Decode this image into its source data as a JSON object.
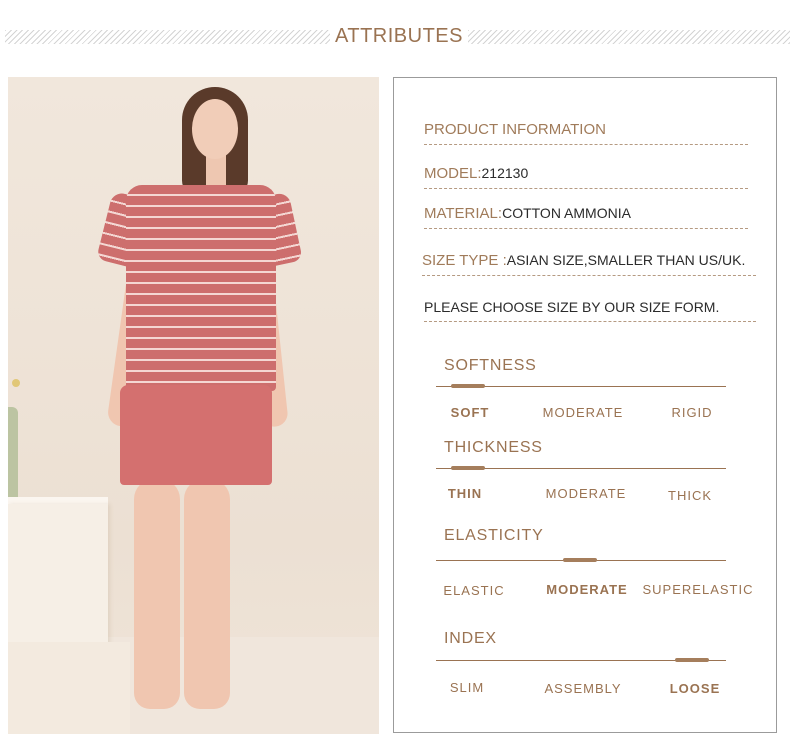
{
  "header": {
    "title": "ATTRIBUTES"
  },
  "product": {
    "info_label": "PRODUCT INFORMATION",
    "model_label": "MODEL:",
    "model_value": "212130",
    "material_label": "MATERIAL:",
    "material_value": "COTTON AMMONIA",
    "size_label": "SIZE TYPE :",
    "size_value": "ASIAN SIZE,SMALLER THAN US/UK.",
    "size_note": "PLEASE CHOOSE SIZE BY OUR SIZE FORM."
  },
  "attributes": [
    {
      "title": "SOFTNESS",
      "options": [
        "SOFT",
        "MODERATE",
        "RIGID"
      ],
      "selected": 0
    },
    {
      "title": "THICKNESS",
      "options": [
        "THIN",
        "MODERATE",
        "THICK"
      ],
      "selected": 0
    },
    {
      "title": "ELASTICITY",
      "options": [
        "ELASTIC",
        "MODERATE",
        "SUPERELASTIC"
      ],
      "selected": 1
    },
    {
      "title": "INDEX",
      "options": [
        "SLIM",
        "ASSEMBLY",
        "LOOSE"
      ],
      "selected": 2
    }
  ],
  "colors": {
    "accent": "#9a7352",
    "shirt": "#cd6e6d",
    "border": "#9b9b9b"
  },
  "photo": {
    "subject": "model-wearing-pink-striped-pajama-set"
  }
}
